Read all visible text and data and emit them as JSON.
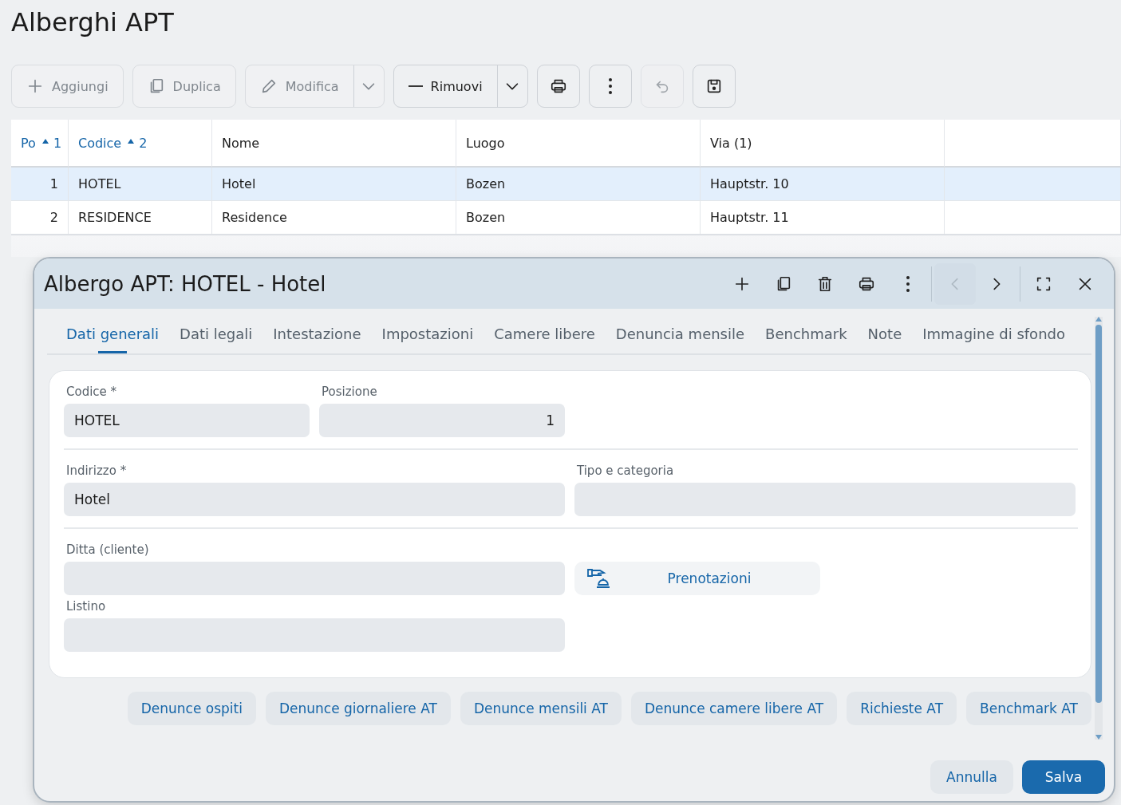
{
  "page": {
    "title": "Alberghi APT"
  },
  "toolbar": [
    {
      "kind": "add",
      "label": "Aggiungi",
      "disabled": true
    },
    {
      "kind": "duplicate",
      "label": "Duplica",
      "disabled": true
    },
    {
      "kind": "edit",
      "label": "Modifica",
      "disabled": true,
      "menu": true
    },
    {
      "kind": "remove",
      "label": "Rimuovi",
      "disabled": false,
      "menu": true
    },
    {
      "kind": "print",
      "disabled": false
    },
    {
      "kind": "more",
      "disabled": false
    },
    {
      "kind": "undo",
      "disabled": true
    },
    {
      "kind": "save",
      "disabled": false
    }
  ],
  "table": {
    "columns": [
      {
        "label": "Po",
        "sort_order": "1",
        "sorted": true
      },
      {
        "label": "Codice",
        "sort_order": "2",
        "sorted": true
      },
      {
        "label": "Nome",
        "sorted": false
      },
      {
        "label": "Luogo",
        "sorted": false
      },
      {
        "label": "Via (1)",
        "sorted": false
      }
    ],
    "rows": [
      {
        "cells": [
          "1",
          "HOTEL",
          "Hotel",
          "Bozen",
          "Hauptstr. 10"
        ],
        "selected": true
      },
      {
        "cells": [
          "2",
          "RESIDENCE",
          "Residence",
          "Bozen",
          "Hauptstr. 11"
        ],
        "selected": false
      }
    ]
  },
  "dialog": {
    "title": "Albergo APT: HOTEL - Hotel",
    "actions": [
      {
        "kind": "add",
        "disabled": false
      },
      {
        "kind": "copy",
        "disabled": false
      },
      {
        "kind": "delete",
        "disabled": false
      },
      {
        "kind": "print",
        "disabled": false
      },
      {
        "kind": "more",
        "disabled": false
      },
      {
        "kind": "previous",
        "disabled": true
      },
      {
        "kind": "next",
        "disabled": false
      },
      {
        "kind": "fullscreen",
        "disabled": false
      },
      {
        "kind": "close",
        "disabled": false
      }
    ],
    "tabs": [
      {
        "label": "Dati generali",
        "selected": true
      },
      {
        "label": "Dati legali",
        "selected": false
      },
      {
        "label": "Intestazione",
        "selected": false
      },
      {
        "label": "Impostazioni",
        "selected": false
      },
      {
        "label": "Camere libere",
        "selected": false
      },
      {
        "label": "Denuncia mensile",
        "selected": false
      },
      {
        "label": "Benchmark",
        "selected": false
      },
      {
        "label": "Note",
        "selected": false
      },
      {
        "label": "Immagine di sfondo",
        "selected": false
      }
    ],
    "sections": [
      {
        "fields": [
          {
            "kind": "text",
            "label": "Codice *",
            "value": "HOTEL"
          },
          {
            "kind": "number",
            "label": "Posizione",
            "value": "1"
          }
        ]
      },
      {
        "fields": [
          {
            "kind": "text",
            "label": "Indirizzo *",
            "value": "Hotel"
          },
          {
            "kind": "text",
            "label": "Tipo e categoria"
          }
        ]
      },
      {
        "fields": [
          {
            "kind": "text",
            "label": "Ditta (cliente)"
          },
          {
            "kind": "button",
            "label": "Prenotazioni"
          },
          {
            "kind": "text",
            "label": "Listino"
          }
        ]
      }
    ],
    "links": [
      "Denunce ospiti",
      "Denunce giornaliere AT",
      "Denunce mensili AT",
      "Denunce camere libere AT",
      "Richieste AT",
      "Benchmark AT"
    ],
    "footer": [
      {
        "kind": "secondary",
        "label": "Annulla"
      },
      {
        "kind": "primary",
        "label": "Salva"
      }
    ]
  }
}
